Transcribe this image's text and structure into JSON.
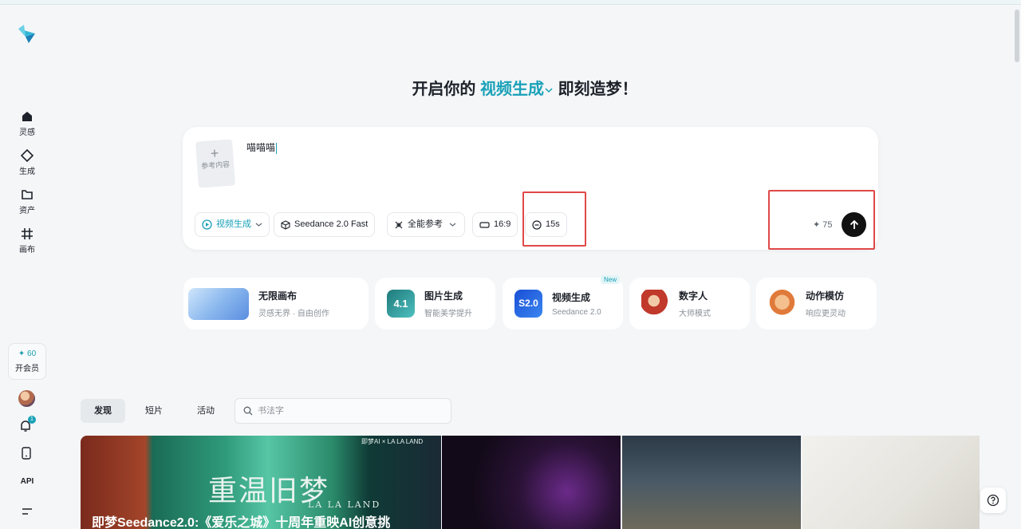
{
  "sidebar": {
    "items": [
      {
        "label": "灵感",
        "icon": "home-icon"
      },
      {
        "label": "生成",
        "icon": "sparkle-diamond-icon"
      },
      {
        "label": "资产",
        "icon": "folder-icon"
      },
      {
        "label": "画布",
        "icon": "canvas-grid-icon"
      }
    ],
    "member": {
      "credits": "✦ 60",
      "label": "开会员"
    },
    "notification_count": "1",
    "api_label": "API"
  },
  "headline": {
    "prefix": "开启你的",
    "mode": "视频生成",
    "suffix": "即刻造梦！"
  },
  "prompt": {
    "reference_label": "参考内容",
    "text": "喵喵喵",
    "chips": {
      "mode": "视频生成",
      "model": "Seedance 2.0 Fast",
      "reference": "全能参考",
      "ratio": "16:9",
      "duration": "15s"
    },
    "cost": "✦ 75"
  },
  "features": [
    {
      "title": "无限画布",
      "subtitle": "灵感无界 · 自由创作"
    },
    {
      "title": "图片生成",
      "subtitle": "智能美学提升",
      "thumb_text": "4.1"
    },
    {
      "title": "视频生成",
      "subtitle": "Seedance 2.0",
      "thumb_text": "S2.0",
      "badge": "New"
    },
    {
      "title": "数字人",
      "subtitle": "大师模式"
    },
    {
      "title": "动作模仿",
      "subtitle": "响应更灵动"
    }
  ],
  "feed": {
    "tabs": [
      "发现",
      "短片",
      "活动"
    ],
    "active_tab": "发现",
    "search_placeholder": "书法字",
    "cards": [
      {
        "art_title": "重温旧梦",
        "art_subtitle": "LA LA LAND",
        "brand": "即梦AI × LA LA LAND",
        "caption": "即梦Seedance2.0:《爱乐之城》十周年重映AI创意挑"
      }
    ]
  },
  "colors": {
    "accent": "#1aa1b8",
    "highlight_box": "#e04848",
    "send_button": "#111111"
  }
}
